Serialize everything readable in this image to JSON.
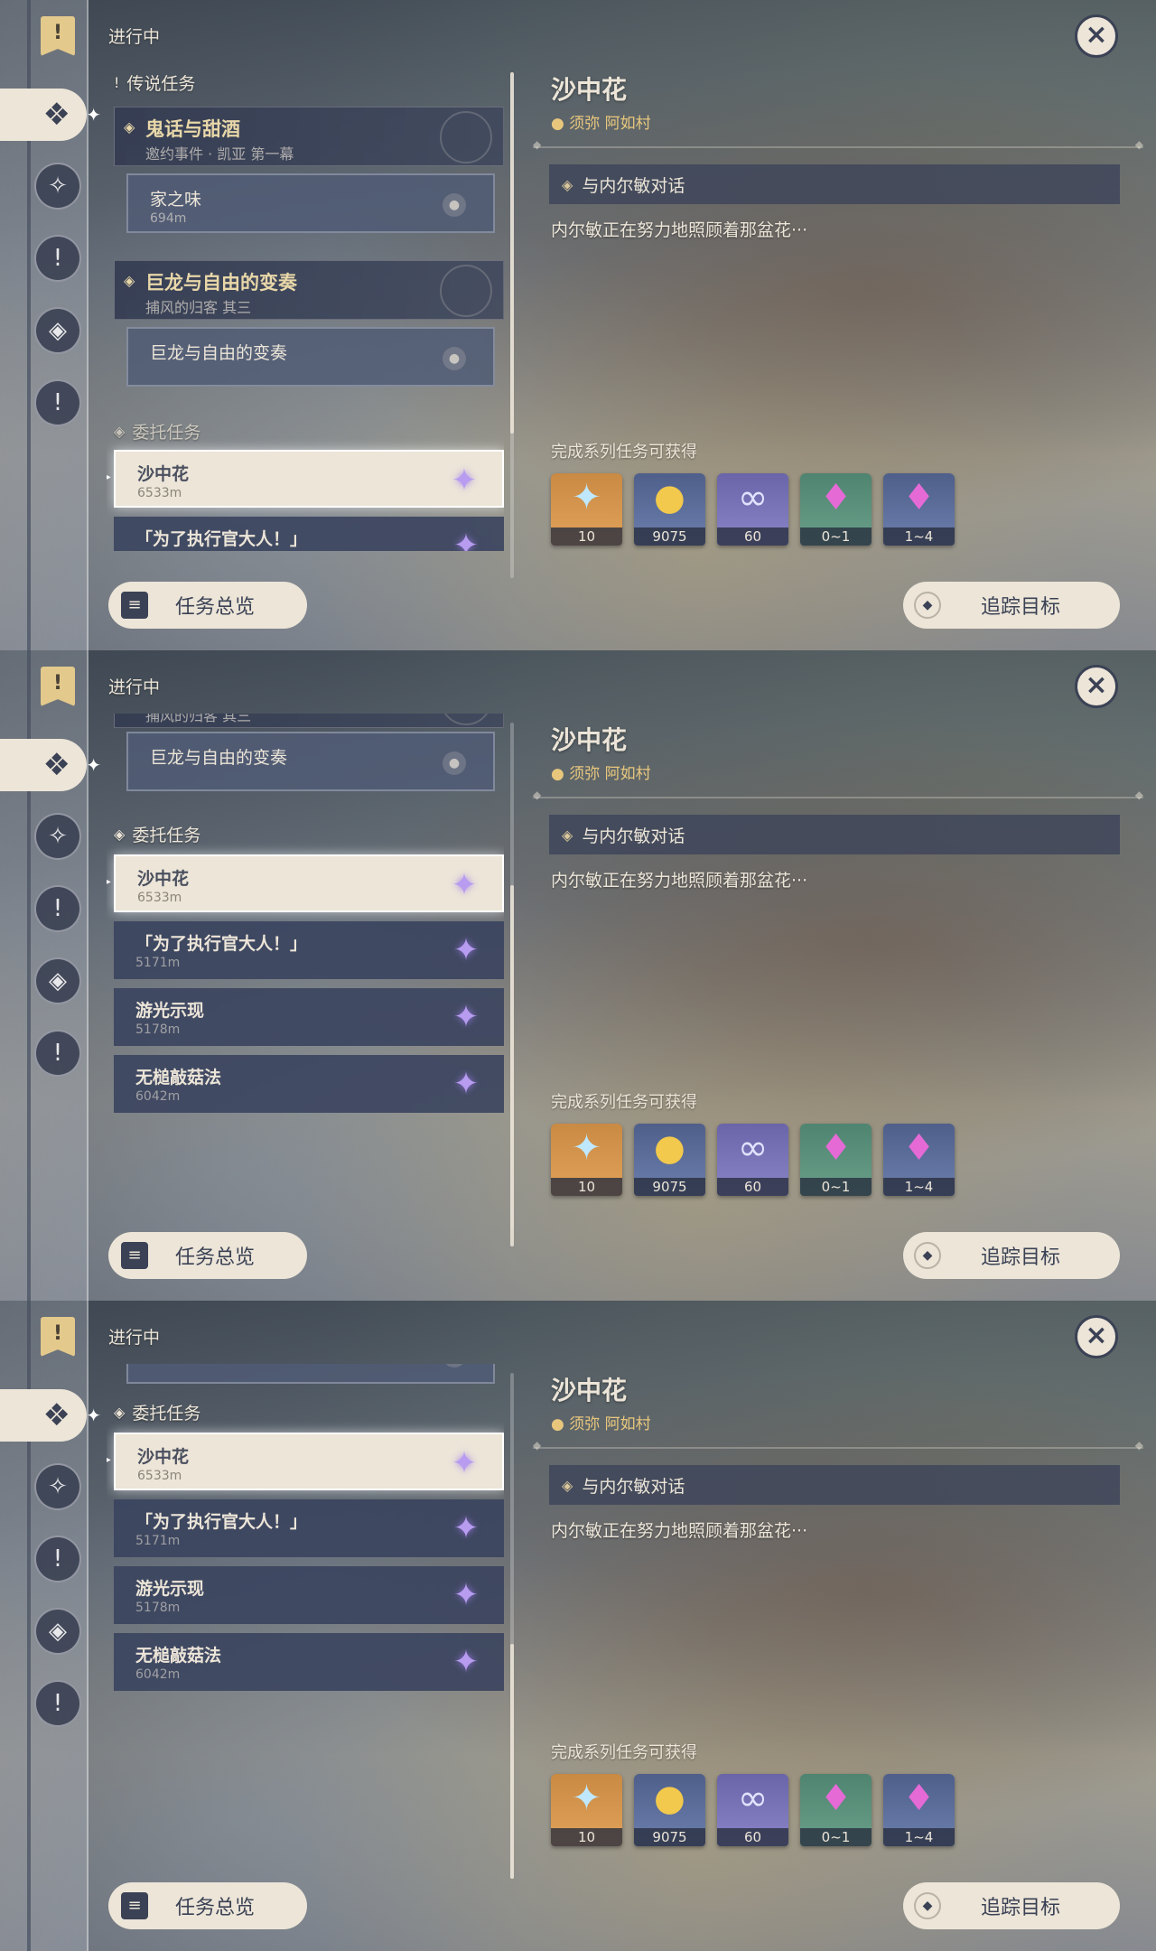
{
  "status": "进行中",
  "legend_section": "传说任务",
  "commission_section": "委托任务",
  "groups": [
    {
      "title": "鬼话与甜酒",
      "subtitle": "邀约事件 · 凯亚 第一幕",
      "sub_name": "家之味",
      "sub_dist": "694m"
    },
    {
      "title": "巨龙与自由的变奏",
      "subtitle": "捕风的归客 其三",
      "sub_name": "巨龙与自由的变奏",
      "sub_dist": ""
    }
  ],
  "tasks": [
    {
      "name": "沙中花",
      "dist": "6533m"
    },
    {
      "name": "「为了执行官大人！」",
      "dist": "5171m"
    },
    {
      "name": "游光示现",
      "dist": "5178m"
    },
    {
      "name": "无槌敲菇法",
      "dist": "6042m"
    }
  ],
  "detail": {
    "title": "沙中花",
    "location": "须弥 阿如村",
    "objective": "与内尔敏对话",
    "description": "内尔敏正在努力地照顾着那盆花···",
    "reward_label": "完成系列任务可获得",
    "rewards": [
      {
        "icon": "primogem-icon",
        "glyph": "✦",
        "count": "10",
        "color": "orange"
      },
      {
        "icon": "mora-icon",
        "glyph": "●",
        "count": "9075",
        "color": "blue"
      },
      {
        "icon": "adventure-exp-icon",
        "glyph": "∞",
        "count": "60",
        "color": "purple"
      },
      {
        "icon": "crystal-icon",
        "glyph": "♦",
        "count": "0~1",
        "color": "green"
      },
      {
        "icon": "crystal-cluster-icon",
        "glyph": "♦",
        "count": "1~4",
        "color": "blue"
      }
    ]
  },
  "buttons": {
    "overview": "任务总览",
    "track": "追踪目标",
    "close": "×"
  },
  "colors": {
    "accent_cream": "#ece5d8",
    "dark_slate": "#3b4255",
    "gold": "#e8c77d"
  }
}
